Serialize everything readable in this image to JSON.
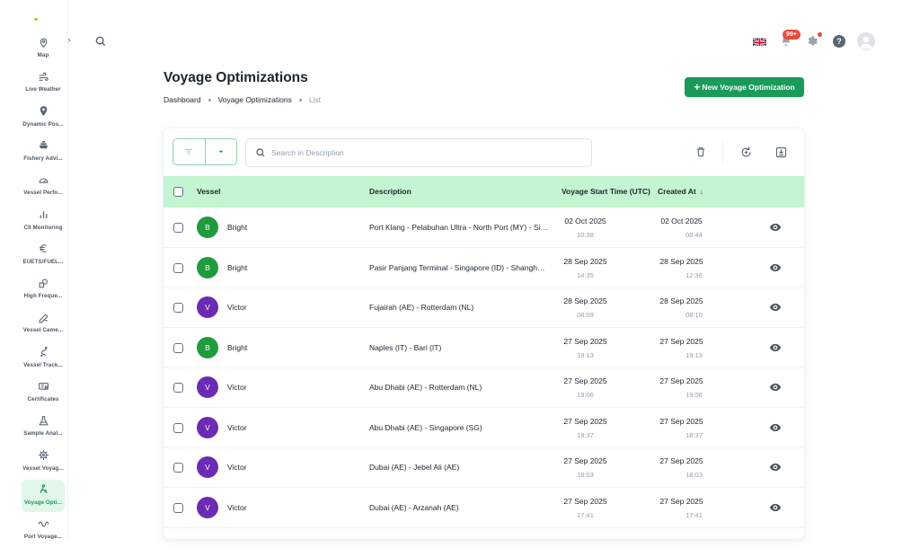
{
  "sidebar": {
    "items": [
      {
        "label": "Map",
        "icon": "map-pin-icon",
        "active": false
      },
      {
        "label": "Live Weather",
        "icon": "wind-icon",
        "active": false
      },
      {
        "label": "Dynamic Pos...",
        "icon": "location-icon",
        "active": false
      },
      {
        "label": "Fishery Advi...",
        "icon": "ship-icon",
        "active": false
      },
      {
        "label": "Vessel Perfo...",
        "icon": "gauge-icon",
        "active": false
      },
      {
        "label": "CII Monitoring",
        "icon": "bar-chart-icon",
        "active": false
      },
      {
        "label": "EUETS/FUEL...",
        "icon": "euro-icon",
        "active": false
      },
      {
        "label": "High Freque...",
        "icon": "frequency-icon",
        "active": false
      },
      {
        "label": "Vessel Came...",
        "icon": "camera-icon",
        "active": false
      },
      {
        "label": "Vessel Track...",
        "icon": "route-icon",
        "active": false
      },
      {
        "label": "Certificates",
        "icon": "certificate-icon",
        "active": false
      },
      {
        "label": "Sample Anal...",
        "icon": "flask-icon",
        "active": false
      },
      {
        "label": "Vessel Voyag...",
        "icon": "helm-icon",
        "active": false
      },
      {
        "label": "Voyage Opti...",
        "icon": "route-optimize-icon",
        "active": true
      },
      {
        "label": "Port Voyage...",
        "icon": "wave-icon",
        "active": false
      }
    ]
  },
  "header": {
    "notification_count": "99+",
    "help_glyph": "?"
  },
  "page": {
    "title": "Voyage Optimizations",
    "breadcrumb": [
      "Dashboard",
      "Voyage Optimizations",
      "List"
    ],
    "new_button_label": "New Voyage Optimization"
  },
  "toolbar": {
    "search_placeholder": "Search in Description"
  },
  "table": {
    "columns": {
      "vessel": "Vessel",
      "description": "Description",
      "start_time": "Voyage Start Time (UTC)",
      "created_at": "Created At"
    },
    "rows": [
      {
        "initial": "B",
        "vessel": "Bright",
        "color": "#1e9b3c",
        "description": "Port Klang - Pelabuhan Ultra - North Port (MY) - Singapore (SG)",
        "start_date": "02 Oct 2025",
        "start_time": "10:38",
        "created_date": "02 Oct 2025",
        "created_time": "08:44"
      },
      {
        "initial": "B",
        "vessel": "Bright",
        "color": "#1e9b3c",
        "description": "Pasir Panjang Terminal - Singapore (ID) - Shanghai (CN)",
        "start_date": "28 Sep 2025",
        "start_time": "14:35",
        "created_date": "28 Sep 2025",
        "created_time": "12:36"
      },
      {
        "initial": "V",
        "vessel": "Victor",
        "color": "#6a2bb5",
        "description": "Fujairah (AE) - Rotterdam (NL)",
        "start_date": "28 Sep 2025",
        "start_time": "08:09",
        "created_date": "28 Sep 2025",
        "created_time": "08:10"
      },
      {
        "initial": "B",
        "vessel": "Bright",
        "color": "#1e9b3c",
        "description": "Naples (IT) - Bari (IT)",
        "start_date": "27 Sep 2025",
        "start_time": "19:13",
        "created_date": "27 Sep 2025",
        "created_time": "19:13"
      },
      {
        "initial": "V",
        "vessel": "Victor",
        "color": "#6a2bb5",
        "description": "Abu Dhabi (AE) - Rotterdam (NL)",
        "start_date": "27 Sep 2025",
        "start_time": "19:06",
        "created_date": "27 Sep 2025",
        "created_time": "19:06"
      },
      {
        "initial": "V",
        "vessel": "Victor",
        "color": "#6a2bb5",
        "description": "Abu Dhabi (AE) - Singapore (SG)",
        "start_date": "27 Sep 2025",
        "start_time": "18:37",
        "created_date": "27 Sep 2025",
        "created_time": "18:37"
      },
      {
        "initial": "V",
        "vessel": "Victor",
        "color": "#6a2bb5",
        "description": "Dubai (AE) - Jebel Ali (AE)",
        "start_date": "27 Sep 2025",
        "start_time": "18:03",
        "created_date": "27 Sep 2025",
        "created_time": "18:03"
      },
      {
        "initial": "V",
        "vessel": "Victor",
        "color": "#6a2bb5",
        "description": "Dubai (AE) - Arzanah (AE)",
        "start_date": "27 Sep 2025",
        "start_time": "17:41",
        "created_date": "27 Sep 2025",
        "created_time": "17:41"
      }
    ]
  },
  "colors": {
    "accent": "#1b9a59",
    "header_bg": "#c4f5d2",
    "badge": "#e84b3c"
  }
}
